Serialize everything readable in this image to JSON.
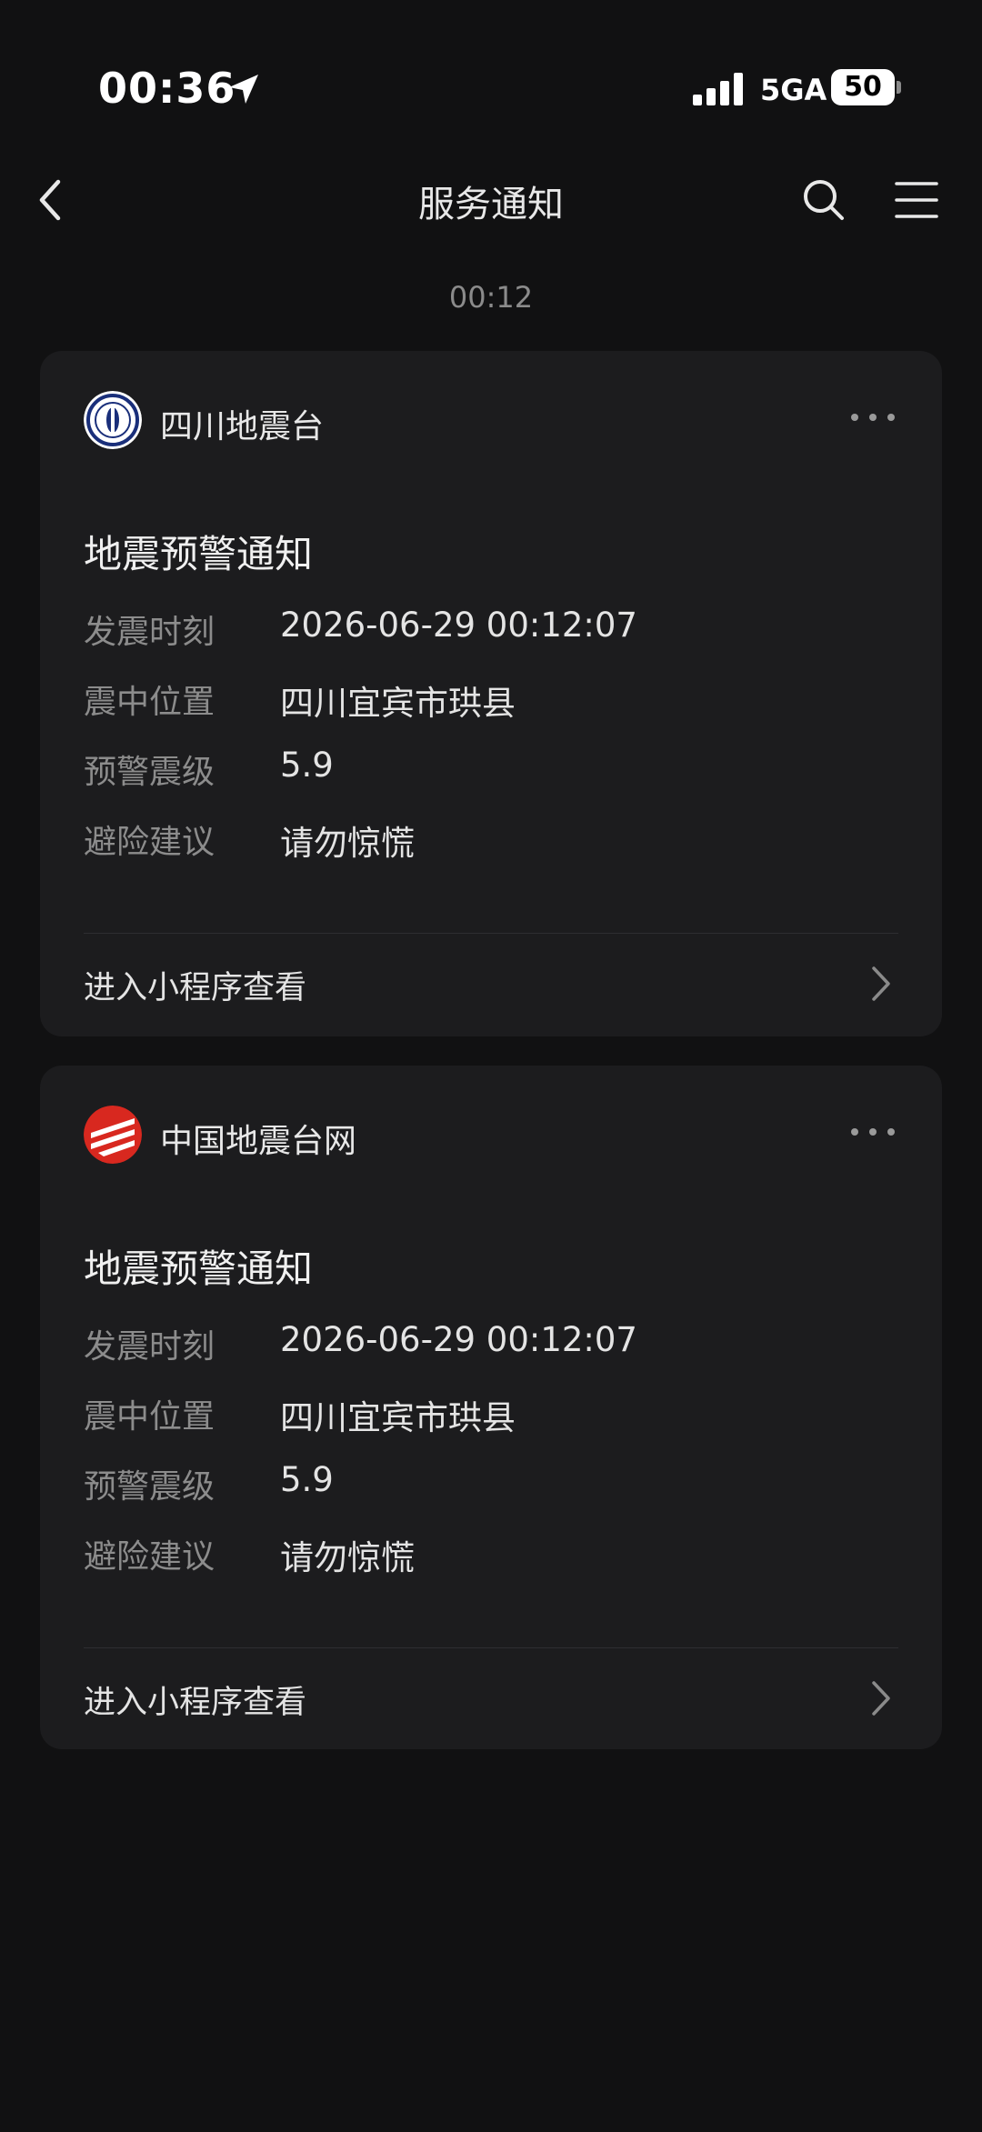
{
  "status_bar": {
    "time": "00:36",
    "network": "5GA",
    "battery": "50",
    "icons": [
      "location-arrow-icon",
      "signal-bars-icon",
      "battery-icon"
    ]
  },
  "nav": {
    "title": "服务通知",
    "icons": [
      "back-icon",
      "search-icon",
      "menu-icon"
    ]
  },
  "timestamp": "00:12",
  "colors": {
    "background": "#111112",
    "card": "#1c1c1e",
    "label": "#8c8c8c",
    "value": "#e4e4e4"
  },
  "notifications": [
    {
      "sender": "四川地震台",
      "title": "地震预警通知",
      "fields": [
        {
          "label": "发震时刻",
          "value": "2026-06-29 00:12:07"
        },
        {
          "label": "震中位置",
          "value": "四川宜宾市珙县"
        },
        {
          "label": "预警震级",
          "value": "5.9"
        },
        {
          "label": "避险建议",
          "value": "请勿惊慌"
        }
      ],
      "link": "进入小程序查看"
    },
    {
      "sender": "中国地震台网",
      "title": "地震预警通知",
      "fields": [
        {
          "label": "发震时刻",
          "value": "2026-06-29 00:12:07"
        },
        {
          "label": "震中位置",
          "value": "四川宜宾市珙县"
        },
        {
          "label": "预警震级",
          "value": "5.9"
        },
        {
          "label": "避险建议",
          "value": "请勿惊慌"
        }
      ],
      "link": "进入小程序查看"
    }
  ]
}
